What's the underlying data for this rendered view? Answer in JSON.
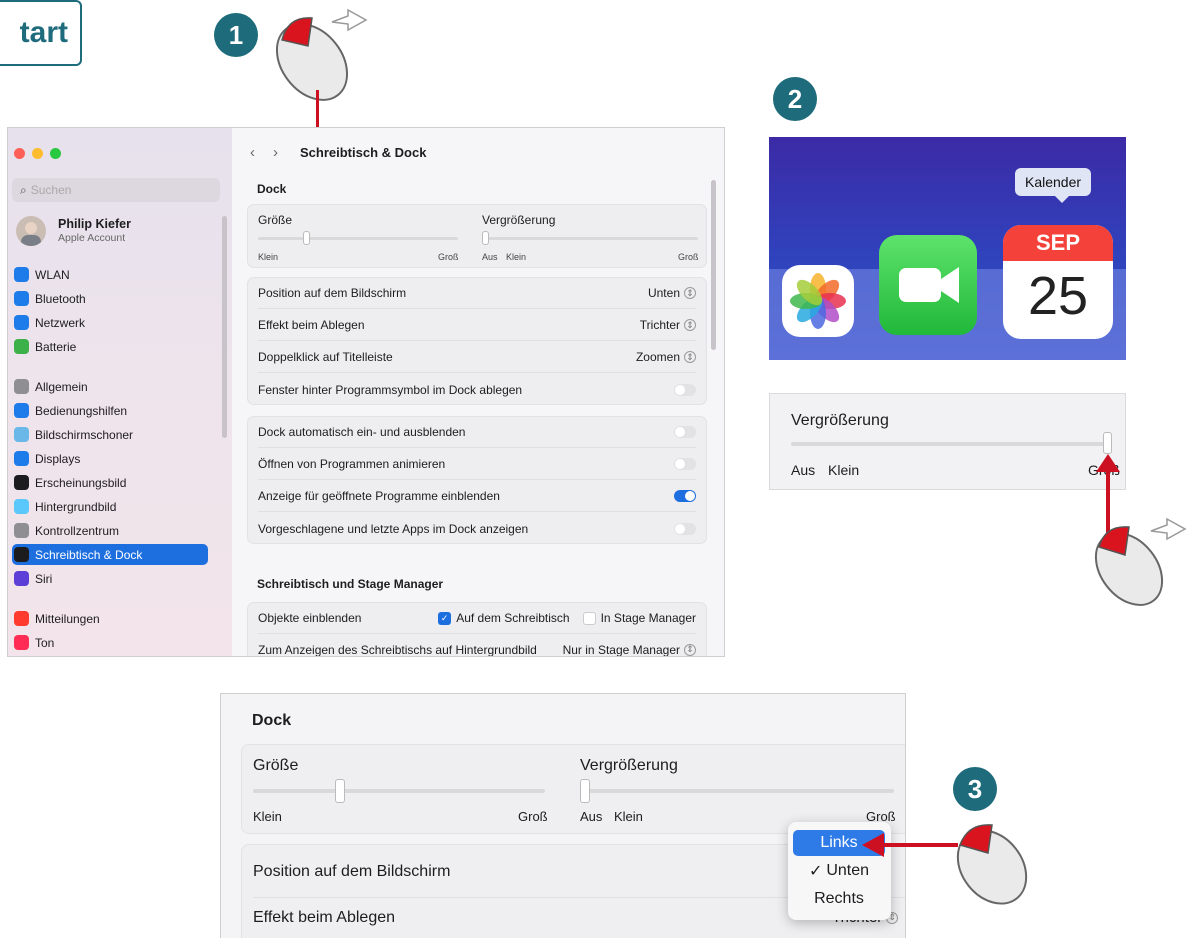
{
  "start_label": "tart",
  "steps": [
    "1",
    "2",
    "3"
  ],
  "window": {
    "search_placeholder": "Suchen",
    "user_name": "Philip Kiefer",
    "user_sub": "Apple Account",
    "title": "Schreibtisch & Dock",
    "nav_back": "‹",
    "nav_forward": "›",
    "sidebar": [
      {
        "label": "WLAN",
        "icon": "wifi-icon",
        "color": "#1d7bea"
      },
      {
        "label": "Bluetooth",
        "icon": "bluetooth-icon",
        "color": "#1d7bea"
      },
      {
        "label": "Netzwerk",
        "icon": "globe-icon",
        "color": "#1d7bea"
      },
      {
        "label": "Batterie",
        "icon": "battery-icon",
        "color": "#3cb14a"
      },
      {
        "label": "Allgemein",
        "icon": "gear-icon",
        "color": "#8e8e93"
      },
      {
        "label": "Bedienungshilfen",
        "icon": "accessibility-icon",
        "color": "#1d7bea"
      },
      {
        "label": "Bildschirmschoner",
        "icon": "screensaver-icon",
        "color": "#6ab8e8"
      },
      {
        "label": "Displays",
        "icon": "display-icon",
        "color": "#1d7bea"
      },
      {
        "label": "Erscheinungsbild",
        "icon": "appearance-icon",
        "color": "#1c1c1e"
      },
      {
        "label": "Hintergrundbild",
        "icon": "wallpaper-icon",
        "color": "#5ac8fa"
      },
      {
        "label": "Kontrollzentrum",
        "icon": "control-center-icon",
        "color": "#8e8e93"
      },
      {
        "label": "Schreibtisch & Dock",
        "icon": "dock-icon",
        "color": "#1c1c1e",
        "selected": true
      },
      {
        "label": "Siri",
        "icon": "siri-icon",
        "color": "#5b3fd6"
      },
      {
        "label": "Mitteilungen",
        "icon": "notifications-icon",
        "color": "#ff3b30"
      },
      {
        "label": "Ton",
        "icon": "sound-icon",
        "color": "#ff2d55"
      }
    ],
    "section_dock": "Dock",
    "size_label": "Größe",
    "size_min": "Klein",
    "size_max": "Groß",
    "size_value_pct": 24,
    "mag_label": "Vergrößerung",
    "mag_off": "Aus",
    "mag_min": "Klein",
    "mag_max": "Groß",
    "mag_value_pct": 0,
    "rows1": [
      {
        "label": "Position auf dem Bildschirm",
        "value": "Unten"
      },
      {
        "label": "Effekt beim Ablegen",
        "value": "Trichter"
      },
      {
        "label": "Doppelklick auf Titelleiste",
        "value": "Zoomen"
      },
      {
        "label": "Fenster hinter Programmsymbol im Dock ablegen",
        "toggle": false
      }
    ],
    "rows2": [
      {
        "label": "Dock automatisch ein- und ausblenden",
        "toggle": false
      },
      {
        "label": "Öffnen von Programmen animieren",
        "toggle": false
      },
      {
        "label": "Anzeige für geöffnete Programme einblenden",
        "toggle": true
      },
      {
        "label": "Vorgeschlagene und letzte Apps im Dock anzeigen",
        "toggle": false
      }
    ],
    "section_stage": "Schreibtisch und Stage Manager",
    "objects_label": "Objekte einblenden",
    "objects_opt1": "Auf dem Schreibtisch",
    "objects_opt2": "In Stage Manager",
    "desk_label": "Zum Anzeigen des Schreibtischs auf Hintergrundbild",
    "desk_value": "Nur in Stage Manager"
  },
  "dock": {
    "tooltip": "Kalender",
    "cal_month": "SEP",
    "cal_day": "25"
  },
  "zoom1": {
    "label": "Vergrößerung",
    "off": "Aus",
    "min": "Klein",
    "max": "Groß",
    "value_pct": 100
  },
  "zoom2": {
    "section": "Dock",
    "size_label": "Größe",
    "size_min": "Klein",
    "size_max": "Groß",
    "size_value_pct": 24,
    "mag_label": "Vergrößerung",
    "mag_off": "Aus",
    "mag_min": "Klein",
    "mag_max": "Groß",
    "mag_value_pct": 0,
    "row1": "Position auf dem Bildschirm",
    "row2": "Effekt beim Ablegen",
    "row2_value": "Trichter"
  },
  "menu": {
    "items": [
      "Links",
      "Unten",
      "Rechts"
    ],
    "checked": 1,
    "highlighted": 0,
    "check": "✓"
  }
}
